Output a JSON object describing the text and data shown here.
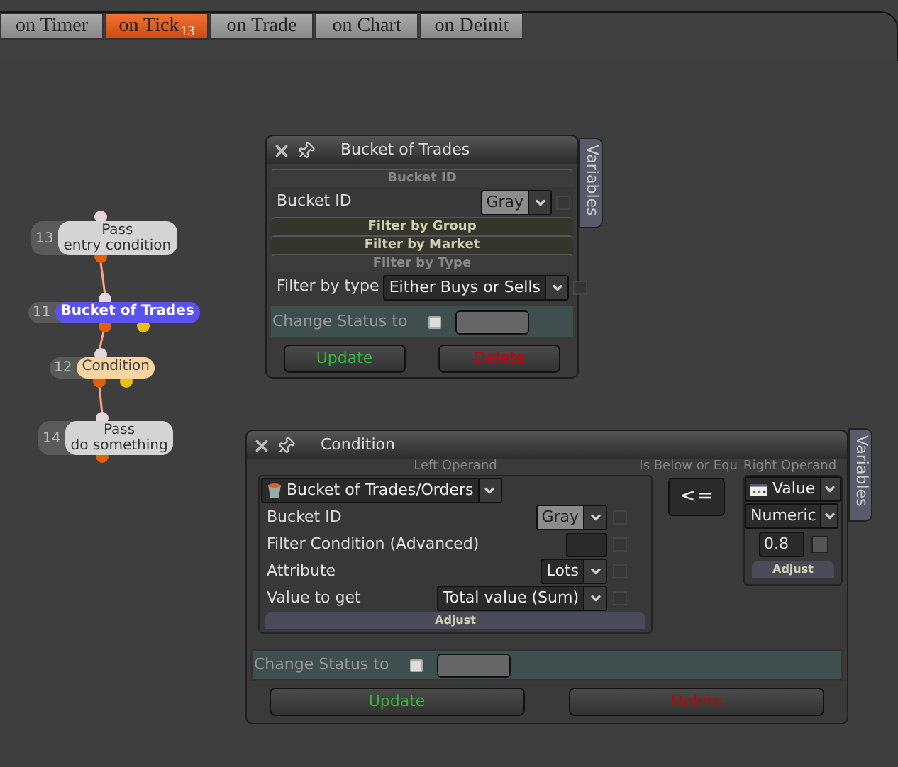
{
  "tabs": [
    {
      "label": "on Timer",
      "selected": false
    },
    {
      "label": "on Tick",
      "selected": true,
      "badge": "13"
    },
    {
      "label": "on Trade",
      "selected": false
    },
    {
      "label": "on Chart",
      "selected": false
    },
    {
      "label": "on Deinit",
      "selected": false
    }
  ],
  "nodes": [
    {
      "number": "13",
      "lines": [
        "Pass",
        "entry condition"
      ],
      "kind": "pass"
    },
    {
      "number": "11",
      "lines": [
        "Bucket of Trades"
      ],
      "kind": "bucket"
    },
    {
      "number": "12",
      "lines": [
        "Condition"
      ],
      "kind": "condition"
    },
    {
      "number": "14",
      "lines": [
        "Pass",
        "do something"
      ],
      "kind": "pass"
    }
  ],
  "bucket_window": {
    "title": "Bucket of Trades",
    "side_tab": "Variables",
    "sections": [
      {
        "title": "Bucket ID",
        "expanded": true,
        "rows": [
          {
            "label": "Bucket ID",
            "value": "Gray",
            "light": true
          }
        ]
      },
      {
        "title": "Filter by Group",
        "expanded": false
      },
      {
        "title": "Filter by Market",
        "expanded": false
      },
      {
        "title": "Filter by Type",
        "expanded": true,
        "rows": [
          {
            "label": "Filter by type",
            "value": "Either Buys or Sells",
            "light": false
          }
        ]
      }
    ],
    "status": {
      "label": "Change Status to",
      "checked": false
    },
    "buttons": [
      {
        "label": "Update",
        "kind": "update"
      },
      {
        "label": "Delete",
        "kind": "delete"
      }
    ]
  },
  "condition_window": {
    "title": "Condition",
    "side_tab": "Variables",
    "left_operand": {
      "caption": "Left Operand",
      "source": "Bucket of Trades/Orders",
      "rows": [
        {
          "label": "Bucket ID",
          "kind": "dropdown",
          "value": "Gray",
          "light": true
        },
        {
          "label": "Filter Condition (Advanced)",
          "kind": "field"
        },
        {
          "label": "Attribute",
          "kind": "dropdown",
          "value": "Lots",
          "light": false
        },
        {
          "label": "Value to get",
          "kind": "dropdown",
          "value": "Total value (Sum)",
          "light": false
        }
      ],
      "adjust": "Adjust"
    },
    "operator": {
      "caption": "Is Below or Equ",
      "symbol": "<="
    },
    "right_operand": {
      "caption": "Right Operand",
      "source": "Value",
      "type": "Numeric",
      "value": "0.8",
      "checked": false,
      "adjust": "Adjust"
    },
    "status": {
      "label": "Change Status to",
      "checked": false
    },
    "buttons": [
      {
        "label": "Update",
        "kind": "update"
      },
      {
        "label": "Delete",
        "kind": "delete"
      }
    ]
  }
}
